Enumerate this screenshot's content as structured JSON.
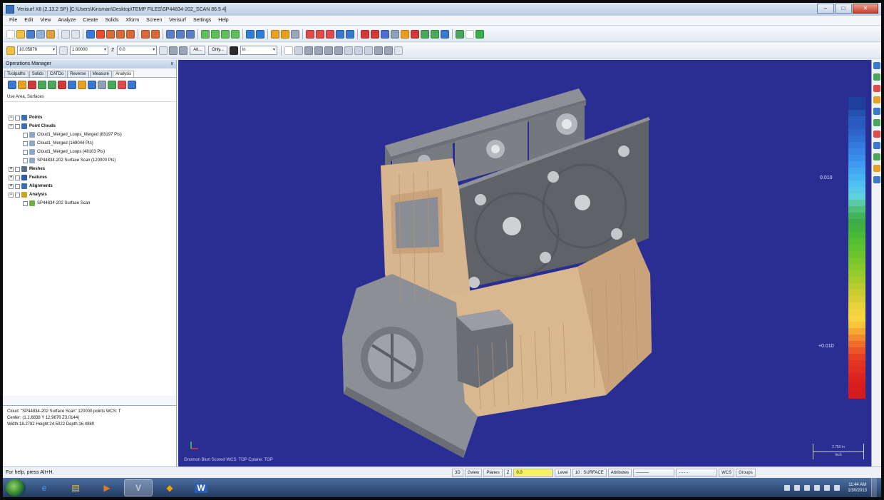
{
  "window": {
    "title": "Verisurf X8 (2.13.2 SP) [C:\\Users\\Kinsman\\Desktop\\TEMP FILES\\SP44834-202_SCAN 86.5 4]",
    "minimize": "–",
    "maximize": "□",
    "close": "✕"
  },
  "menu": [
    "File",
    "Edit",
    "View",
    "Analyze",
    "Create",
    "Solids",
    "Xform",
    "Screen",
    "Verisurf",
    "Settings",
    "Help"
  ],
  "toolbar2": {
    "level_value": "10.05876",
    "tolerance_value": "1.00000",
    "z_label": "Z",
    "z_value": "0.0",
    "btn_all": "All...",
    "btn_only": "Only...",
    "units_value": "in"
  },
  "left_panel": {
    "header": "Operations Manager",
    "close": "x",
    "tabs": [
      "Toolpaths",
      "Solids",
      "CATDo",
      "Reverse",
      "Measure",
      "Analysis"
    ],
    "active_tab_index": 5,
    "mode_text": "Use Area, Surfaces",
    "tree": [
      {
        "label": "Points",
        "bold": true,
        "level": 0,
        "icon_color": "#3a6fb5"
      },
      {
        "label": "Point Clouds",
        "bold": true,
        "level": 0,
        "icon_color": "#3a6fb5"
      },
      {
        "label": "Cloud1_Merged_Loops_Merged (83197 Pts)",
        "bold": false,
        "level": 1,
        "icon_color": "#8fa8c6"
      },
      {
        "label": "Cloud1_Merged (169044 Pts)",
        "bold": false,
        "level": 1,
        "icon_color": "#8fa8c6"
      },
      {
        "label": "Cloud1_Merged_Loops (48103 Pts)",
        "bold": false,
        "level": 1,
        "icon_color": "#8fa8c6"
      },
      {
        "label": "SP44834-202 Surface Scan (120000 Pts)",
        "bold": false,
        "level": 1,
        "icon_color": "#8fa8c6"
      },
      {
        "label": "Meshes",
        "bold": true,
        "level": 0,
        "icon_color": "#5b6f8c"
      },
      {
        "label": "Features",
        "bold": true,
        "level": 0,
        "icon_color": "#2f5bb3"
      },
      {
        "label": "Alignments",
        "bold": true,
        "level": 0,
        "icon_color": "#3a6fb5"
      },
      {
        "label": "Analysis",
        "bold": true,
        "level": 0,
        "icon_color": "#c9a329"
      },
      {
        "label": "SP44834-202 Surface Scan",
        "bold": false,
        "level": 1,
        "icon_color": "#6fae3f"
      }
    ],
    "info": [
      "Cloud: \"SP44834-202 Surface Scan\" 120000 points   WCS: T",
      "Center: (1.1.6838 Y 12.9876 Z3.0144)",
      "Width:18.2782 Height:24.5022 Depth:16.4880"
    ]
  },
  "viewport": {
    "background": "#2a2e92",
    "status": "Gnomon Blurt Scored   WCS: TOP   Cplane: TOP",
    "scale_top": "2.750 in",
    "scale_bottom": "Inch",
    "legend_labels": {
      "upper": "0.010",
      "lower": "+0.010"
    },
    "legend_colors": [
      "#1f3f9c",
      "#1f3f9c",
      "#2451b0",
      "#2a5cc0",
      "#2a5cc0",
      "#2d64c9",
      "#2f6fd3",
      "#3379de",
      "#3784e6",
      "#3c8eec",
      "#3f9af0",
      "#43a7f4",
      "#49b4f5",
      "#4fbff3",
      "#58c8ea",
      "#5ed1df",
      "#59c9a8",
      "#4fbf7c",
      "#43b45a",
      "#3dac46",
      "#42b23f",
      "#4bb938",
      "#55bf33",
      "#5fc230",
      "#6bc42e",
      "#79c72d",
      "#88c92c",
      "#97ca2c",
      "#a7cb2d",
      "#b8cc2f",
      "#c9cd32",
      "#d9ce35",
      "#e8d23a",
      "#f2d53e",
      "#f8d63f",
      "#f9c53a",
      "#f6a834",
      "#f28b2e",
      "#ee6e2a",
      "#ea5527",
      "#e64024",
      "#e33422",
      "#e02c21",
      "#dd2420",
      "#da1f1f",
      "#d71c1e",
      "#d51a1d"
    ]
  },
  "status_bar": {
    "hint": "For help, press Alt+H.",
    "items": [
      "3D",
      "Gview",
      "Planes",
      "Z",
      "0.0",
      "Level",
      "10 : SURFACE",
      "Attributes",
      "WCS",
      "Groups"
    ]
  },
  "taskbar": {
    "apps": [
      {
        "name": "internet-explorer",
        "glyph": "e",
        "color": "#3a8ee6",
        "active": false
      },
      {
        "name": "file-explorer",
        "glyph": "▤",
        "color": "#e8c04a",
        "active": false
      },
      {
        "name": "media-player",
        "glyph": "▶",
        "color": "#e07a22",
        "active": false
      },
      {
        "name": "verisurf",
        "glyph": "V",
        "color": "#c2c7cf",
        "active": true
      },
      {
        "name": "picture-viewer",
        "glyph": "◆",
        "color": "#f0a000",
        "active": false
      },
      {
        "name": "word",
        "glyph": "W",
        "color": "#2b5fb3",
        "active": false
      }
    ],
    "time": "11:44 AM",
    "date": "1/30/2013"
  }
}
